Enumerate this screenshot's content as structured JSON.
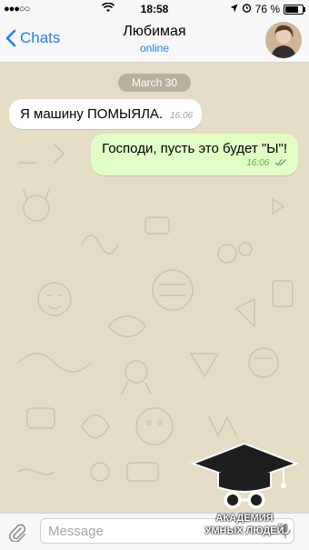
{
  "status_bar": {
    "carrier": "●●●○○",
    "time": "18:58",
    "battery": "76 %",
    "battery_level": 0.76
  },
  "header": {
    "back_label": "Chats",
    "title": "Любимая",
    "subtitle": "online"
  },
  "chat": {
    "date": "March 30",
    "messages": [
      {
        "direction": "in",
        "text": "Я машину ПОМЫЯЛА.",
        "time": "16:06"
      },
      {
        "direction": "out",
        "text": "Господи, пусть это будет \"Ы\"!",
        "time": "16:06"
      }
    ]
  },
  "composer": {
    "placeholder": "Message"
  },
  "watermark": {
    "line1": "АКАДЕМИЯ",
    "line2": "УМНЫХ ЛЮДЕЙ"
  },
  "colors": {
    "accent": "#1f7ff2",
    "outgoing_bubble": "#e1fec6",
    "incoming_bubble": "#ffffff",
    "wallpaper": "#e4dcc4"
  },
  "icons": [
    "chevron-left-icon",
    "wifi-icon",
    "location-arrow-icon",
    "alarm-icon",
    "battery-icon",
    "double-check-icon",
    "paperclip-icon",
    "microphone-icon"
  ]
}
